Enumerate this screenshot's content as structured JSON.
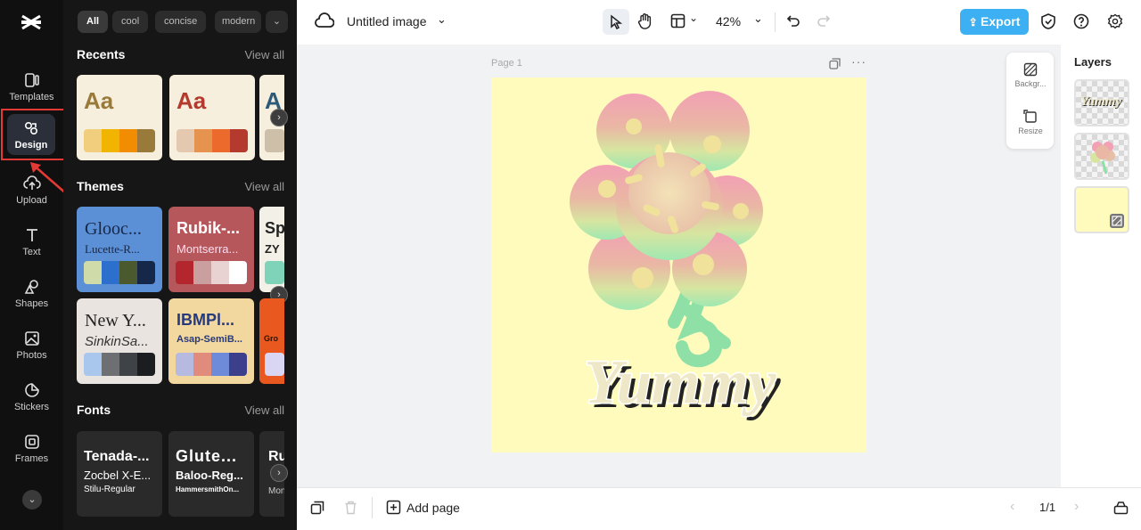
{
  "rail": {
    "items": [
      {
        "label": "Templates",
        "icon": "templates-icon"
      },
      {
        "label": "Design",
        "icon": "design-icon"
      },
      {
        "label": "Upload",
        "icon": "upload-icon"
      },
      {
        "label": "Text",
        "icon": "text-icon"
      },
      {
        "label": "Shapes",
        "icon": "shapes-icon"
      },
      {
        "label": "Photos",
        "icon": "photos-icon"
      },
      {
        "label": "Stickers",
        "icon": "stickers-icon"
      },
      {
        "label": "Frames",
        "icon": "frames-icon"
      }
    ]
  },
  "panel": {
    "chips": [
      "All",
      "cool",
      "concise",
      "modern"
    ],
    "recents": {
      "title": "Recents",
      "view_all": "View all",
      "cards": [
        {
          "label": "Aa"
        },
        {
          "label": "Aa"
        },
        {
          "label": "A"
        }
      ]
    },
    "themes": {
      "title": "Themes",
      "view_all": "View all",
      "cards": [
        {
          "title": "Glooc...",
          "sub": "Lucette-R..."
        },
        {
          "title": "Rubik-...",
          "sub": "Montserra..."
        },
        {
          "title": "Sp",
          "sub": "ZY"
        },
        {
          "title": "New Y...",
          "sub": "SinkinSa..."
        },
        {
          "title": "IBMPl...",
          "sub": "Asap-SemiB..."
        },
        {
          "title": "",
          "sub": "Gro"
        }
      ]
    },
    "fonts": {
      "title": "Fonts",
      "view_all": "View all",
      "cards": [
        {
          "l1": "Tenada-...",
          "l2": "Zocbel X-E...",
          "l3": "Stilu-Regular"
        },
        {
          "l1": "Glute...",
          "l2": "Baloo-Reg...",
          "l3": "HammersmithOn..."
        },
        {
          "l1": "Ru",
          "l2": "",
          "l3": "Mon"
        }
      ]
    }
  },
  "topbar": {
    "title": "Untitled image",
    "zoom": "42%",
    "export_label": "Export"
  },
  "canvas": {
    "page_label": "Page 1",
    "artwork_text": "Yummy"
  },
  "side_tools": [
    {
      "label": "Backgr..."
    },
    {
      "label": "Resize"
    }
  ],
  "layers": {
    "title": "Layers"
  },
  "bottombar": {
    "add_page": "Add page",
    "pagination": "1/1"
  },
  "colors": {
    "accent": "#3cb0f2",
    "highlight": "#e53935",
    "page_bg": "#fffbbd"
  }
}
